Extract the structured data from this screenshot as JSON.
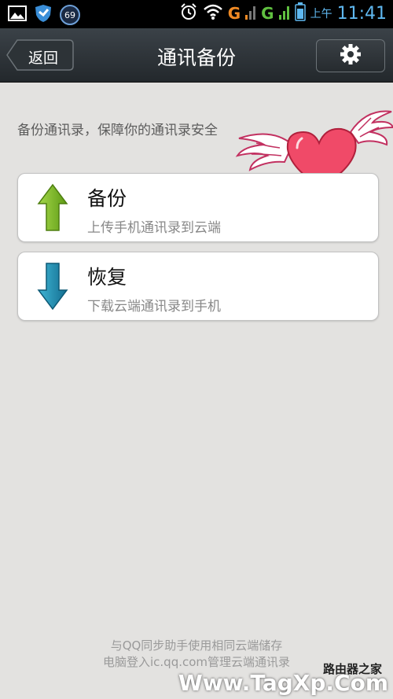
{
  "status_bar": {
    "notification_count": "69",
    "network_1": "G",
    "network_2": "G",
    "ampm": "上午",
    "time": "11:41",
    "colors": {
      "accent": "#5fb8f0",
      "network_1": "#f08a24",
      "network_2": "#60c040"
    }
  },
  "header": {
    "back_label": "返回",
    "title": "通讯备份"
  },
  "main": {
    "description": "备份通讯录，保障你的通讯录安全",
    "actions": [
      {
        "title": "备份",
        "subtitle": "上传手机通讯录到云端",
        "icon": "up-arrow-icon",
        "color": "#7cbd23"
      },
      {
        "title": "恢复",
        "subtitle": "下载云端通讯录到手机",
        "icon": "down-arrow-icon",
        "color": "#1f8fb0"
      }
    ]
  },
  "footer": {
    "line1": "与QQ同步助手使用相同云端储存",
    "line2": "电脑登入ic.qq.com管理云端通讯录"
  },
  "watermark": {
    "text": "Www.TagXp.Com",
    "text2": "路由器之家"
  }
}
